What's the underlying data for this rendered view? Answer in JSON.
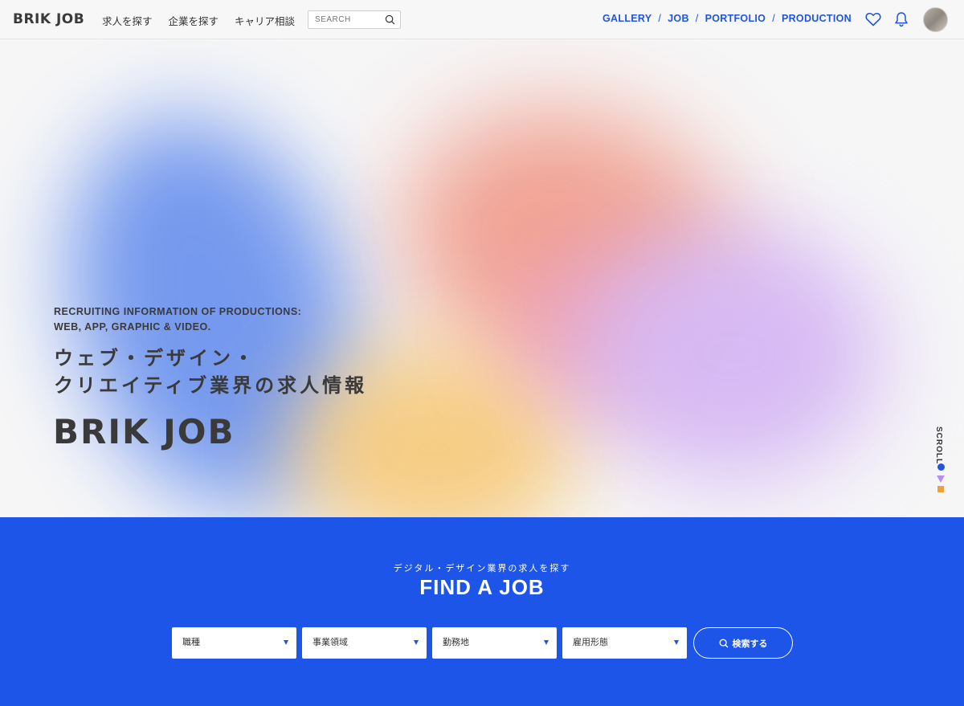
{
  "header": {
    "logo": "BRIK JOB",
    "nav_left": [
      "求人を探す",
      "企業を探す",
      "キャリア相談"
    ],
    "search_placeholder": "SEARCH",
    "nav_right": [
      "GALLERY",
      "JOB",
      "PORTFOLIO",
      "PRODUCTION"
    ],
    "separator": "/"
  },
  "hero": {
    "subtitle_line1": "RECRUITING INFORMATION OF PRODUCTIONS:",
    "subtitle_line2": "WEB, APP, GRAPHIC & VIDEO.",
    "title_line1": "ウェブ・デザイン・",
    "title_line2": "クリエイティブ業界の求人情報",
    "logo": "BRIK JOB",
    "scroll_label": "SCROLL"
  },
  "find": {
    "subtitle": "デジタル・デザイン業界の求人を探す",
    "title": "FIND A JOB",
    "selects": [
      "職種",
      "事業領域",
      "勤務地",
      "雇用形態"
    ],
    "search_button": "検索する"
  },
  "colors": {
    "accent": "#1f55e0",
    "find_bg": "#1d55e8"
  }
}
